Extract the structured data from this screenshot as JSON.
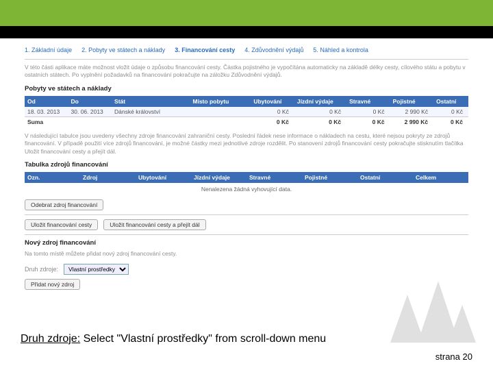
{
  "steps": [
    {
      "num": "1.",
      "label": "Základní údaje"
    },
    {
      "num": "2.",
      "label": "Pobyty ve státech a náklady"
    },
    {
      "num": "3.",
      "label": "Financování cesty"
    },
    {
      "num": "4.",
      "label": "Zdůvodnění výdajů"
    },
    {
      "num": "5.",
      "label": "Náhled a kontrola"
    }
  ],
  "desc1": "V této části aplikace máte možnost vložit údaje o způsobu financování cesty. Částka pojistného je vypočítána automaticky na základě délky cesty, cílového státu a pobytu v ostatních státech. Po vyplnění požadavků na financování pokračujte na záložku Zdůvodnění výdajů.",
  "section_pobyty": "Pobyty ve státech a náklady",
  "pobyty_headers": [
    "Od",
    "Do",
    "Stát",
    "Místo pobytu",
    "Ubytování",
    "Jízdní výdaje",
    "Stravné",
    "Pojistné",
    "Ostatní"
  ],
  "pobyty_row": {
    "od": "18. 03. 2013",
    "do": "30. 06. 2013",
    "stat": "Dánské království",
    "misto": "",
    "ubyt": "0 Kč",
    "jizd": "0 Kč",
    "strav": "0 Kč",
    "poj": "2 990 Kč",
    "ost": "0 Kč"
  },
  "suma_label": "Suma",
  "suma": {
    "ubyt": "0 Kč",
    "jizd": "0 Kč",
    "strav": "0 Kč",
    "poj": "2 990 Kč",
    "ost": "0 Kč"
  },
  "desc2": "V následující tabulce jsou uvedeny všechny zdroje financování zahraniční cesty. Poslední řádek nese informace o nákladech na cestu, které nejsou pokryty ze zdrojů financování. V případě použití více zdrojů financování, je možné částky mezi jednotlivé zdroje rozdělit. Po stanovení zdrojů financování cesty pokračujte stisknutím tlačítka Uložit financování cesty a přejít dál.",
  "section_zdroje": "Tabulka zdrojů financování",
  "zdroje_headers": [
    "Ozn.",
    "Zdroj",
    "Ubytování",
    "Jízdní výdaje",
    "Stravné",
    "Pojistné",
    "Ostatní",
    "Celkem"
  ],
  "nodata": "Nenalezena žádná vyhovující data.",
  "btn_remove": "Odebrat zdroj financování",
  "btn_save": "Uložit financování cesty",
  "btn_save_next": "Uložit financování cesty a přejít dál",
  "section_novy": "Nový zdroj financování",
  "desc3": "Na tomto místě můžete přidat nový zdroj financování cesty.",
  "druh_label": "Druh zdroje:",
  "druh_value": "Vlastní prostředky",
  "btn_add": "Přidat nový zdroj",
  "annotation_prefix": "Druh zdroje:",
  "annotation_rest": " Select \"Vlastní prostředky\" from scroll-down menu",
  "page_label": "strana",
  "page_num": "20"
}
